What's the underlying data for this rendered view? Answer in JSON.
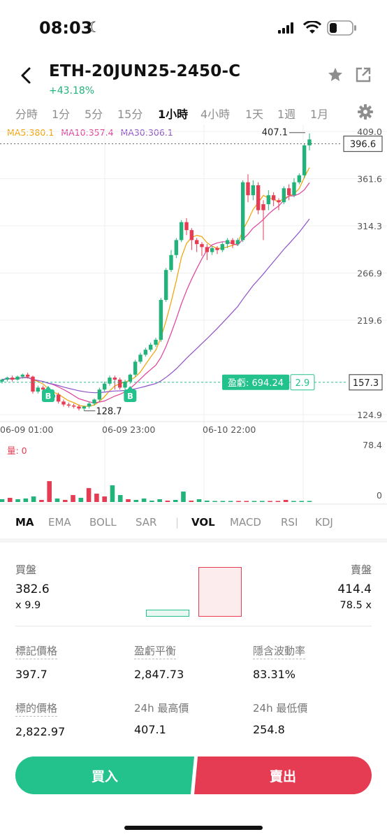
{
  "status_bar": {
    "time": "08:03"
  },
  "header": {
    "title": "ETH-20JUN25-2450-C",
    "change": "+43.18%"
  },
  "timeframes": {
    "items": [
      "分時",
      "1分",
      "5分",
      "15分",
      "1小時",
      "4小時",
      "1天",
      "1週",
      "1月"
    ],
    "active": "1小時"
  },
  "ma_legend": {
    "ma5": "MA5:380.1",
    "ma10": "MA10:357.4",
    "ma30": "MA30:306.1"
  },
  "colors": {
    "up": "#21b37a",
    "down": "#e53c54",
    "ma5": "#f2a100",
    "ma10": "#e0409b",
    "ma30": "#8f52c9",
    "accent_green": "#23c28d"
  },
  "chart_data": {
    "type": "candlestick",
    "y_ticks": [
      "409.0",
      "361.6",
      "314.3",
      "266.9",
      "219.6",
      "124.9"
    ],
    "y_range": [
      124.9,
      409.0
    ],
    "x_labels": [
      "06-09 01:00",
      "06-09 23:00",
      "06-10 22:00"
    ],
    "current_price": "396.6",
    "high_marker": "407.1",
    "low_marker": "128.7",
    "pnl_label": "盈虧: 694.24",
    "pnl_qty": "2.9",
    "entry_price": "157.3",
    "buy_markers": [
      "B",
      "B"
    ],
    "candles": [
      [
        158,
        160,
        156,
        161,
        "up"
      ],
      [
        160,
        162,
        158,
        163,
        "up"
      ],
      [
        162,
        160,
        158,
        164,
        "down"
      ],
      [
        160,
        163,
        159,
        164,
        "up"
      ],
      [
        163,
        165,
        161,
        166,
        "up"
      ],
      [
        165,
        163,
        161,
        167,
        "down"
      ],
      [
        163,
        148,
        146,
        164,
        "down"
      ],
      [
        148,
        152,
        146,
        154,
        "up"
      ],
      [
        152,
        150,
        148,
        154,
        "down"
      ],
      [
        150,
        142,
        140,
        152,
        "down"
      ],
      [
        142,
        145,
        140,
        147,
        "up"
      ],
      [
        145,
        138,
        136,
        147,
        "down"
      ],
      [
        138,
        135,
        133,
        140,
        "down"
      ],
      [
        135,
        134,
        132,
        137,
        "down"
      ],
      [
        134,
        133,
        131,
        136,
        "down"
      ],
      [
        133,
        131,
        129,
        135,
        "down"
      ],
      [
        131,
        133,
        128.7,
        134,
        "up"
      ],
      [
        133,
        136,
        131,
        138,
        "up"
      ],
      [
        136,
        140,
        134,
        141,
        "up"
      ],
      [
        140,
        150,
        138,
        152,
        "up"
      ],
      [
        150,
        156,
        148,
        158,
        "up"
      ],
      [
        156,
        162,
        154,
        164,
        "up"
      ],
      [
        162,
        160,
        150,
        164,
        "down"
      ],
      [
        160,
        152,
        150,
        162,
        "down"
      ],
      [
        152,
        158,
        150,
        160,
        "up"
      ],
      [
        158,
        165,
        156,
        166,
        "up"
      ],
      [
        165,
        178,
        163,
        180,
        "up"
      ],
      [
        178,
        185,
        176,
        187,
        "up"
      ],
      [
        185,
        190,
        183,
        192,
        "up"
      ],
      [
        190,
        195,
        188,
        197,
        "up"
      ],
      [
        195,
        200,
        193,
        202,
        "up"
      ],
      [
        200,
        240,
        198,
        242,
        "up"
      ],
      [
        240,
        270,
        238,
        272,
        "up"
      ],
      [
        270,
        285,
        268,
        290,
        "up"
      ],
      [
        285,
        300,
        282,
        302,
        "up"
      ],
      [
        300,
        318,
        298,
        320,
        "up"
      ],
      [
        318,
        310,
        305,
        322,
        "down"
      ],
      [
        310,
        300,
        290,
        312,
        "down"
      ],
      [
        300,
        296,
        288,
        302,
        "down"
      ],
      [
        296,
        293,
        284,
        298,
        "down"
      ],
      [
        293,
        288,
        280,
        296,
        "down"
      ],
      [
        288,
        292,
        285,
        294,
        "up"
      ],
      [
        292,
        290,
        286,
        294,
        "down"
      ],
      [
        290,
        296,
        288,
        298,
        "up"
      ],
      [
        296,
        300,
        292,
        302,
        "up"
      ],
      [
        300,
        296,
        292,
        302,
        "down"
      ],
      [
        296,
        300,
        294,
        302,
        "up"
      ],
      [
        300,
        358,
        298,
        360,
        "up"
      ],
      [
        358,
        345,
        338,
        366,
        "down"
      ],
      [
        345,
        355,
        340,
        360,
        "up"
      ],
      [
        355,
        330,
        326,
        358,
        "down"
      ],
      [
        330,
        336,
        300,
        340,
        "down"
      ],
      [
        336,
        345,
        330,
        350,
        "up"
      ],
      [
        345,
        340,
        334,
        348,
        "down"
      ],
      [
        340,
        338,
        330,
        342,
        "down"
      ],
      [
        338,
        352,
        336,
        354,
        "up"
      ],
      [
        352,
        345,
        340,
        356,
        "down"
      ],
      [
        345,
        358,
        343,
        362,
        "up"
      ],
      [
        358,
        365,
        356,
        367,
        "up"
      ],
      [
        365,
        395,
        362,
        397,
        "up"
      ],
      [
        395,
        401,
        390,
        407.1,
        "up"
      ]
    ],
    "volume_ticks": [
      "78.4",
      "0"
    ],
    "volume_label": "量: 0",
    "volume": [
      [
        4,
        "up"
      ],
      [
        6,
        "down"
      ],
      [
        4,
        "up"
      ],
      [
        5,
        "up"
      ],
      [
        8,
        "up"
      ],
      [
        3,
        "down"
      ],
      [
        30,
        "down"
      ],
      [
        5,
        "up"
      ],
      [
        3,
        "down"
      ],
      [
        10,
        "down"
      ],
      [
        6,
        "up"
      ],
      [
        20,
        "down"
      ],
      [
        12,
        "down"
      ],
      [
        8,
        "down"
      ],
      [
        24,
        "up"
      ],
      [
        10,
        "up"
      ],
      [
        4,
        "down"
      ],
      [
        3,
        "up"
      ],
      [
        5,
        "up"
      ],
      [
        2,
        "up"
      ],
      [
        4,
        "up"
      ],
      [
        2,
        "down"
      ],
      [
        3,
        "up"
      ],
      [
        15,
        "up"
      ],
      [
        2,
        "down"
      ],
      [
        4,
        "up"
      ],
      [
        2,
        "up"
      ],
      [
        1,
        "up"
      ],
      [
        1,
        "up"
      ],
      [
        1,
        "up"
      ],
      [
        1,
        "down"
      ],
      [
        1,
        "down"
      ],
      [
        1,
        "up"
      ],
      [
        1,
        "up"
      ],
      [
        1,
        "down"
      ],
      [
        1,
        "down"
      ],
      [
        3,
        "down"
      ],
      [
        1,
        "up"
      ],
      [
        1,
        "up"
      ],
      [
        1,
        "up"
      ]
    ]
  },
  "indicators": {
    "items": [
      "MA",
      "EMA",
      "BOLL",
      "SAR",
      "VOL",
      "MACD",
      "RSI",
      "KDJ"
    ],
    "active": [
      "MA",
      "VOL"
    ]
  },
  "orderbook": {
    "bid_label": "買盤",
    "ask_label": "賣盤",
    "bid_price": "382.6",
    "bid_size": "x 9.9",
    "ask_price": "414.4",
    "ask_size": "78.5 x"
  },
  "stats": [
    {
      "label": "標記價格",
      "value": "397.7"
    },
    {
      "label": "盈虧平衡",
      "value": "2,847.73"
    },
    {
      "label": "隱含波動率",
      "value": "83.31%"
    },
    {
      "label": "標的價格",
      "value": "2,822.97"
    },
    {
      "label": "24h 最高價",
      "value": "407.1"
    },
    {
      "label": "24h 最低價",
      "value": "254.8"
    }
  ],
  "actions": {
    "buy": "買入",
    "sell": "賣出"
  }
}
